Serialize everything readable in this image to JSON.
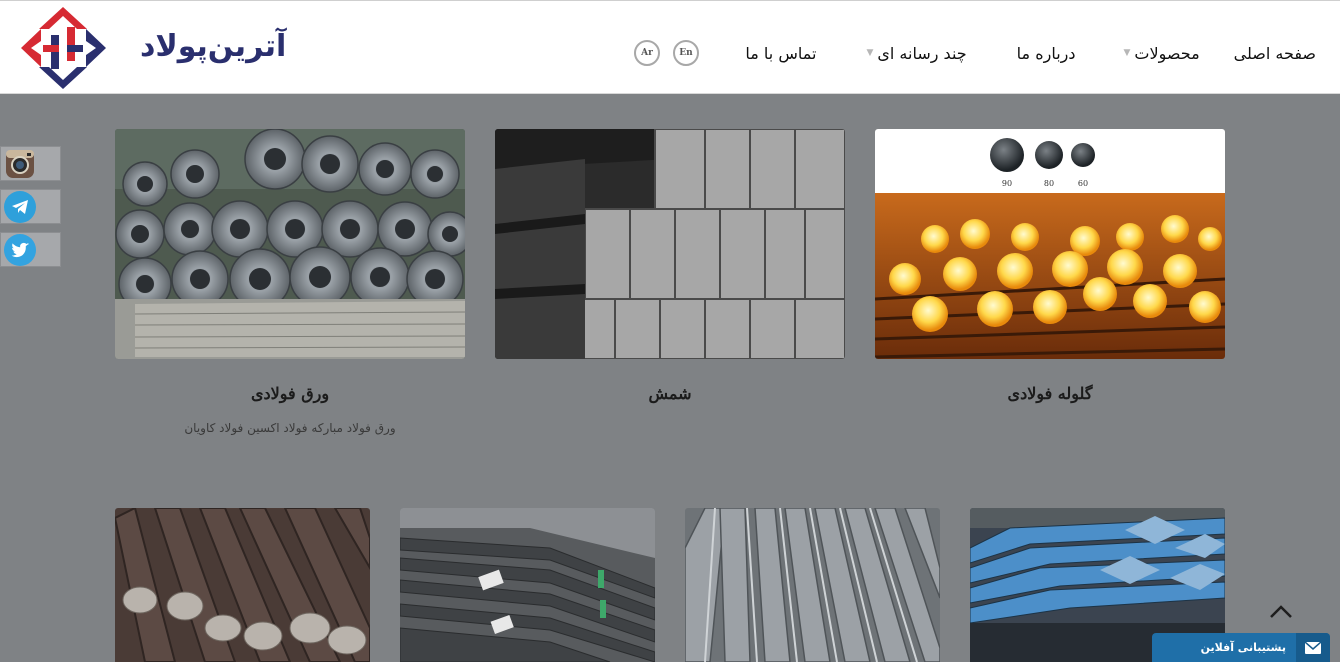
{
  "brand": {
    "name": "آترین‌پولاد",
    "colors": {
      "navy": "#2a2f6e",
      "red": "#d62a33"
    }
  },
  "nav": {
    "items": [
      {
        "label": "صفحه اصلی",
        "has_dropdown": false
      },
      {
        "label": "محصولات",
        "has_dropdown": true
      },
      {
        "label": "درباره ما",
        "has_dropdown": false
      },
      {
        "label": "چند رسانه ای",
        "has_dropdown": true
      },
      {
        "label": "تماس با ما",
        "has_dropdown": false
      }
    ],
    "languages": [
      "En",
      "Ar"
    ]
  },
  "social": [
    {
      "icon": "instagram-icon"
    },
    {
      "icon": "telegram-icon"
    },
    {
      "icon": "twitter-icon"
    }
  ],
  "products_row1": [
    {
      "title": "گلوله فولادی",
      "description": "",
      "ball_labels": [
        "90",
        "80",
        "60"
      ]
    },
    {
      "title": "شمش",
      "description": ""
    },
    {
      "title": "ورق فولادی",
      "description": "ورق فولاد مبارکه فولاد اکسین فولاد کاویان"
    }
  ],
  "support": {
    "label": "پشتیبانی آفلاین",
    "icon": "envelope-icon"
  },
  "scroll_top": {
    "icon": "chevron-up-icon"
  }
}
